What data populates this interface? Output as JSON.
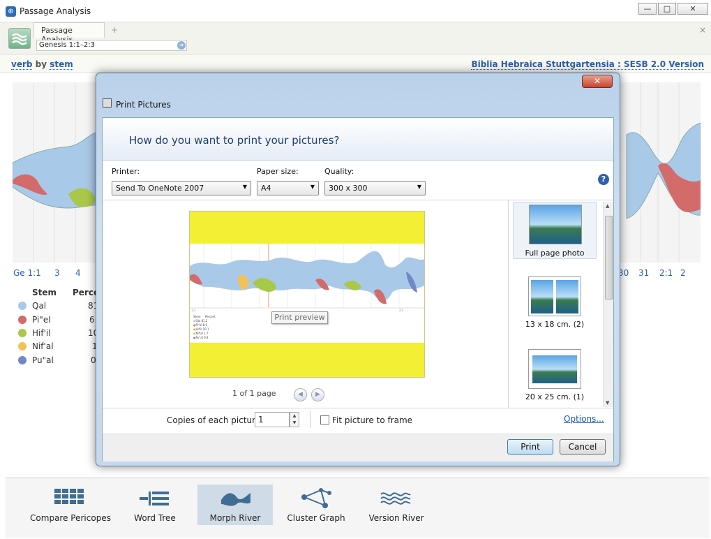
{
  "window": {
    "title": "Passage Analysis",
    "buttons": [
      "—",
      "□",
      "✕"
    ]
  },
  "tabs": {
    "active": "Passage Analysis",
    "add": "+",
    "close": "×"
  },
  "reference": {
    "value": "Genesis 1:1–2:3"
  },
  "infobar": {
    "left_a": "verb",
    "left_by": " by ",
    "left_b": "stem",
    "right": "Biblia Hebraica Stuttgartensia : SESB 2.0 Version"
  },
  "river_axis": {
    "left": [
      "Ge 1:1",
      "3",
      "4"
    ],
    "right": [
      "30",
      "31",
      "2:1",
      "2"
    ]
  },
  "legend": {
    "header_stem": "Stem",
    "header_percent": "Percer",
    "items": [
      {
        "label": "Qal",
        "value": "81",
        "color": "#a9c9e8"
      },
      {
        "label": "Pi\"el",
        "value": "6",
        "color": "#d36b6b"
      },
      {
        "label": "Hif'il",
        "value": "10",
        "color": "#a9c84a"
      },
      {
        "label": "Nif'al",
        "value": "1",
        "color": "#f2c25a"
      },
      {
        "label": "Pu\"al",
        "value": "0",
        "color": "#7088c4"
      }
    ]
  },
  "bottom_nav": [
    {
      "label": "Compare Pericopes",
      "icon": "compare-pericopes-icon"
    },
    {
      "label": "Word Tree",
      "icon": "word-tree-icon"
    },
    {
      "label": "Morph River",
      "icon": "morph-river-icon",
      "selected": true
    },
    {
      "label": "Cluster Graph",
      "icon": "cluster-graph-icon"
    },
    {
      "label": "Version River",
      "icon": "version-river-icon"
    }
  ],
  "dialog": {
    "title": "Print Pictures",
    "close": "✕",
    "question": "How do you want to print your pictures?",
    "printer": {
      "label": "Printer:",
      "value": "Send To OneNote 2007"
    },
    "paper": {
      "label": "Paper size:",
      "value": "A4"
    },
    "quality": {
      "label": "Quality:",
      "value": "300 x 300"
    },
    "help": "?",
    "tooltip": "Print preview",
    "page_text": "1 of 1 page",
    "layouts": [
      {
        "label": "Full page photo",
        "selected": true
      },
      {
        "label": "13 x 18 cm. (2)"
      },
      {
        "label": "20 x 25 cm. (1)"
      }
    ],
    "copies_label": "Copies of each picture:",
    "copies_value": "1",
    "fit_label": "Fit picture to frame",
    "options_link": "Options...",
    "print_button": "Print",
    "cancel_button": "Cancel",
    "mini_legend": {
      "header_stem": "Stem",
      "header_percent": "Percent",
      "items": [
        {
          "label": "Qal",
          "value": "81.2"
        },
        {
          "label": "Pi\"el",
          "value": "8.0"
        },
        {
          "label": "Hif'il",
          "value": "10.1"
        },
        {
          "label": "Nif'al",
          "value": "1.7"
        },
        {
          "label": "Pu\"al",
          "value": "0.9"
        }
      ]
    }
  }
}
